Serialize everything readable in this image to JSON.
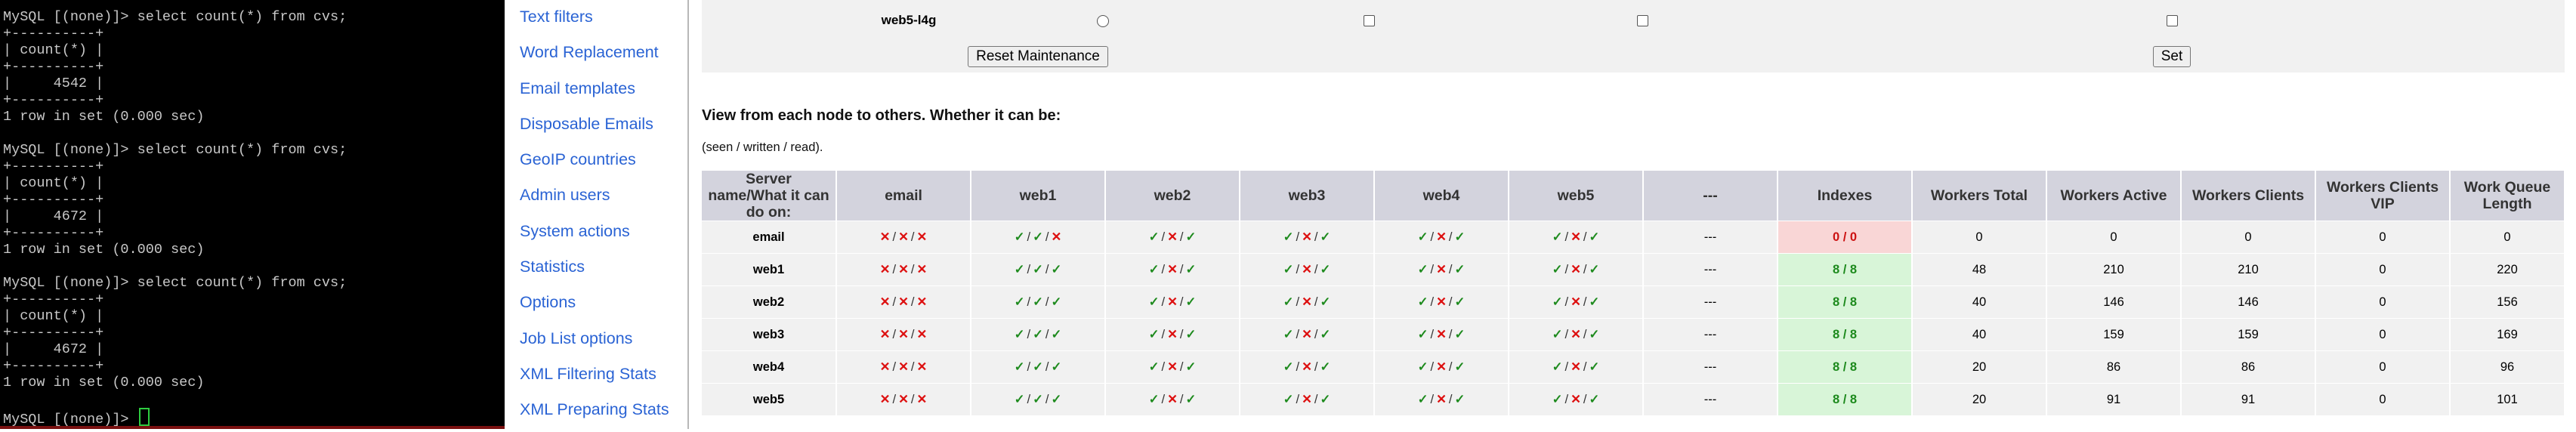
{
  "terminal": {
    "lines": [
      "MySQL [(none)]> select count(*) from cvs;",
      "+----------+",
      "| count(*) |",
      "+----------+",
      "|     4542 |",
      "+----------+",
      "1 row in set (0.000 sec)",
      "",
      "MySQL [(none)]> select count(*) from cvs;",
      "+----------+",
      "| count(*) |",
      "+----------+",
      "|     4672 |",
      "+----------+",
      "1 row in set (0.000 sec)",
      "",
      "MySQL [(none)]> select count(*) from cvs;",
      "+----------+",
      "| count(*) |",
      "+----------+",
      "|     4672 |",
      "+----------+",
      "1 row in set (0.000 sec)",
      ""
    ],
    "prompt": "MySQL [(none)]> "
  },
  "nav": {
    "items": [
      "Text filters",
      "Word Replacement",
      "Email templates",
      "Disposable Emails",
      "GeoIP countries",
      "Admin users",
      "System actions",
      "Statistics",
      "Options",
      "Job List options",
      "XML Filtering Stats",
      "XML Preparing Stats"
    ]
  },
  "maintenance": {
    "row_label": "web5-l4g",
    "reset_button": "Reset Maintenance",
    "set_button": "Set"
  },
  "view": {
    "title": "View from each node to others. Whether it can be:",
    "subtitle": "(seen / written / read)."
  },
  "matrix": {
    "headers": [
      "Server name/What it can do on:",
      "email",
      "web1",
      "web2",
      "web3",
      "web4",
      "web5",
      "---",
      "Indexes",
      "Workers Total",
      "Workers Active",
      "Workers Clients",
      "Workers Clients VIP",
      "Work Queue Length"
    ],
    "rows": [
      {
        "name": "email",
        "perms": [
          "xxx",
          "vvx",
          "vxv",
          "vxv",
          "vxv",
          "vxv"
        ],
        "dash": "---",
        "indexes": "0 / 0",
        "indexes_ok": false,
        "total": "0",
        "active": "0",
        "clients": "0",
        "vip": "0",
        "queue": "0"
      },
      {
        "name": "web1",
        "perms": [
          "xxx",
          "vvv",
          "vxv",
          "vxv",
          "vxv",
          "vxv"
        ],
        "dash": "---",
        "indexes": "8 / 8",
        "indexes_ok": true,
        "total": "48",
        "active": "210",
        "clients": "210",
        "vip": "0",
        "queue": "220"
      },
      {
        "name": "web2",
        "perms": [
          "xxx",
          "vvv",
          "vxv",
          "vxv",
          "vxv",
          "vxv"
        ],
        "dash": "---",
        "indexes": "8 / 8",
        "indexes_ok": true,
        "total": "40",
        "active": "146",
        "clients": "146",
        "vip": "0",
        "queue": "156"
      },
      {
        "name": "web3",
        "perms": [
          "xxx",
          "vvv",
          "vxv",
          "vxv",
          "vxv",
          "vxv"
        ],
        "dash": "---",
        "indexes": "8 / 8",
        "indexes_ok": true,
        "total": "40",
        "active": "159",
        "clients": "159",
        "vip": "0",
        "queue": "169"
      },
      {
        "name": "web4",
        "perms": [
          "xxx",
          "vvv",
          "vxv",
          "vxv",
          "vxv",
          "vxv"
        ],
        "dash": "---",
        "indexes": "8 / 8",
        "indexes_ok": true,
        "total": "20",
        "active": "86",
        "clients": "86",
        "vip": "0",
        "queue": "96"
      },
      {
        "name": "web5",
        "perms": [
          "xxx",
          "vvv",
          "vxv",
          "vxv",
          "vxv",
          "vxv"
        ],
        "dash": "---",
        "indexes": "8 / 8",
        "indexes_ok": true,
        "total": "20",
        "active": "91",
        "clients": "91",
        "vip": "0",
        "queue": "101"
      }
    ]
  },
  "colors": {
    "ok": "#1d8a1d",
    "no": "#d11111",
    "link": "#2a63d4",
    "header_bg": "#d3d3dd"
  },
  "icons": {
    "check": "check-mark-icon",
    "cross": "cross-mark-icon"
  }
}
